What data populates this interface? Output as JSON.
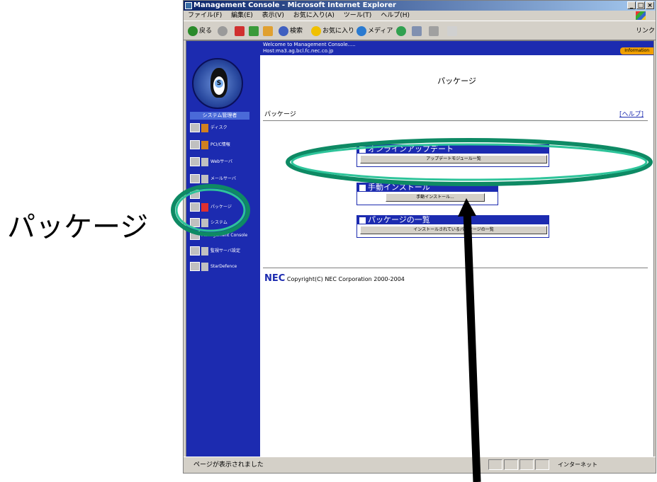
{
  "annotation": {
    "label": "パッケージ"
  },
  "window": {
    "title": "Management Console - Microsoft Internet Explorer",
    "controls": [
      "_",
      "□",
      "×"
    ]
  },
  "menubar": [
    "ファイル(F)",
    "編集(E)",
    "表示(V)",
    "お気に入り(A)",
    "ツール(T)",
    "ヘルプ(H)"
  ],
  "toolbar": {
    "back": "戻る",
    "search": "検索",
    "favorites": "お気に入り",
    "media": "メディア",
    "links": "リンク"
  },
  "ribbon": {
    "line1": "Welcome to Management Console.....",
    "line2": "Host:ma3.ag.bcl.fc.nec.co.jp",
    "info": "Information"
  },
  "sidebar": {
    "logo_letter": "S",
    "heading": "システム管理者",
    "items": [
      {
        "label": "ディスク"
      },
      {
        "label": "PCI/C情報"
      },
      {
        "label": "Webサーバ"
      },
      {
        "label": "メールサーバ"
      },
      {
        "label": ""
      },
      {
        "label": "パッケージ"
      },
      {
        "label": "システム"
      },
      {
        "label": "Management Console"
      },
      {
        "label": "監視サーバ設定"
      },
      {
        "label": "StarDefence"
      }
    ]
  },
  "main": {
    "title": "パッケージ",
    "section": "パッケージ",
    "help": "[ヘルプ]",
    "boxes": [
      {
        "heading": "オンラインアップデート",
        "button": "アップデートモジュール一覧"
      },
      {
        "heading": "手動インストール",
        "button": "手動インストール..."
      },
      {
        "heading": "パッケージの一覧",
        "button": "インストールされているパッケージの一覧"
      }
    ],
    "footer_logo": "NEC",
    "footer_text": "Copyright(C) NEC Corporation 2000-2004"
  },
  "status": {
    "text": "ページが表示されました",
    "zone": "インターネット"
  },
  "colors": {
    "accent": "#1c2bb0",
    "highlight": "#12a37a",
    "info": "#f0a000"
  }
}
